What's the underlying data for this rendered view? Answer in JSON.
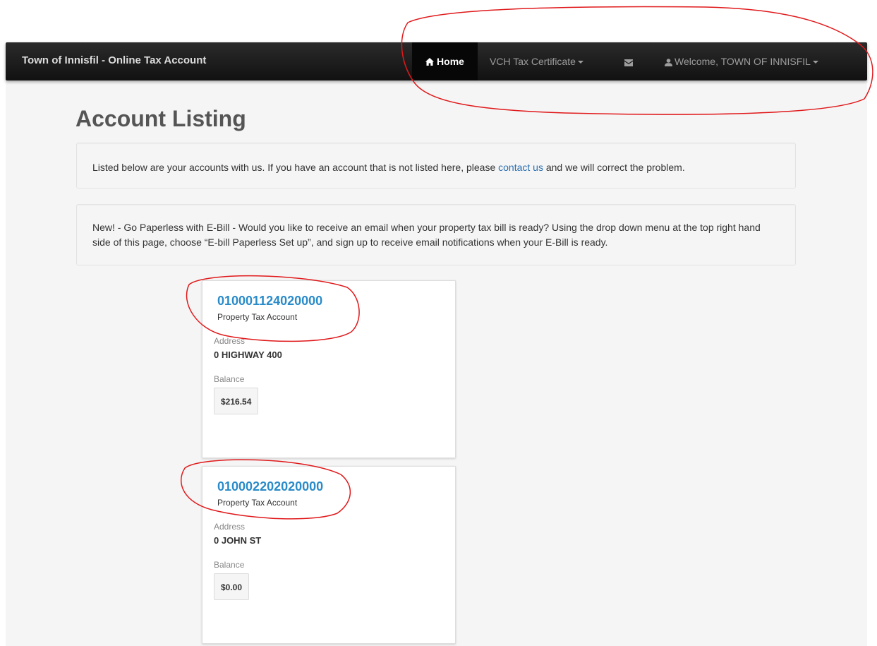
{
  "navbar": {
    "brand": "Town of Innisfil - Online Tax Account",
    "home_label": "Home",
    "vch_label": "VCH Tax Certificate",
    "welcome_label": "Welcome, TOWN OF INNISFIL"
  },
  "page": {
    "title": "Account Listing"
  },
  "notice": {
    "text_before": "Listed below are your accounts with us. If you have an account that is not listed here, please ",
    "link": "contact us",
    "text_after": " and we will correct the problem."
  },
  "ebill": {
    "text": "New! - Go Paperless with E-Bill - Would you like to receive an email when your property tax bill is ready? Using the drop down menu at the top right hand side of this page, choose “E-bill Paperless Set up”, and sign up to receive email notifications when your E-Bill is ready."
  },
  "accounts": [
    {
      "number": "010001124020000",
      "type": "Property Tax Account",
      "address_label": "Address",
      "address": "0 HIGHWAY 400",
      "balance_label": "Balance",
      "balance": "$216.54"
    },
    {
      "number": "010002202020000",
      "type": "Property Tax Account",
      "address_label": "Address",
      "address": "0 JOHN ST",
      "balance_label": "Balance",
      "balance": "$0.00"
    }
  ],
  "icons": {
    "home": "home-icon",
    "mail": "envelope-icon",
    "user": "user-icon",
    "caret": "caret-down-icon"
  },
  "colors": {
    "navbar": "#1a1a1a",
    "link": "#2a8bc9",
    "annotation": "#e0191b"
  }
}
